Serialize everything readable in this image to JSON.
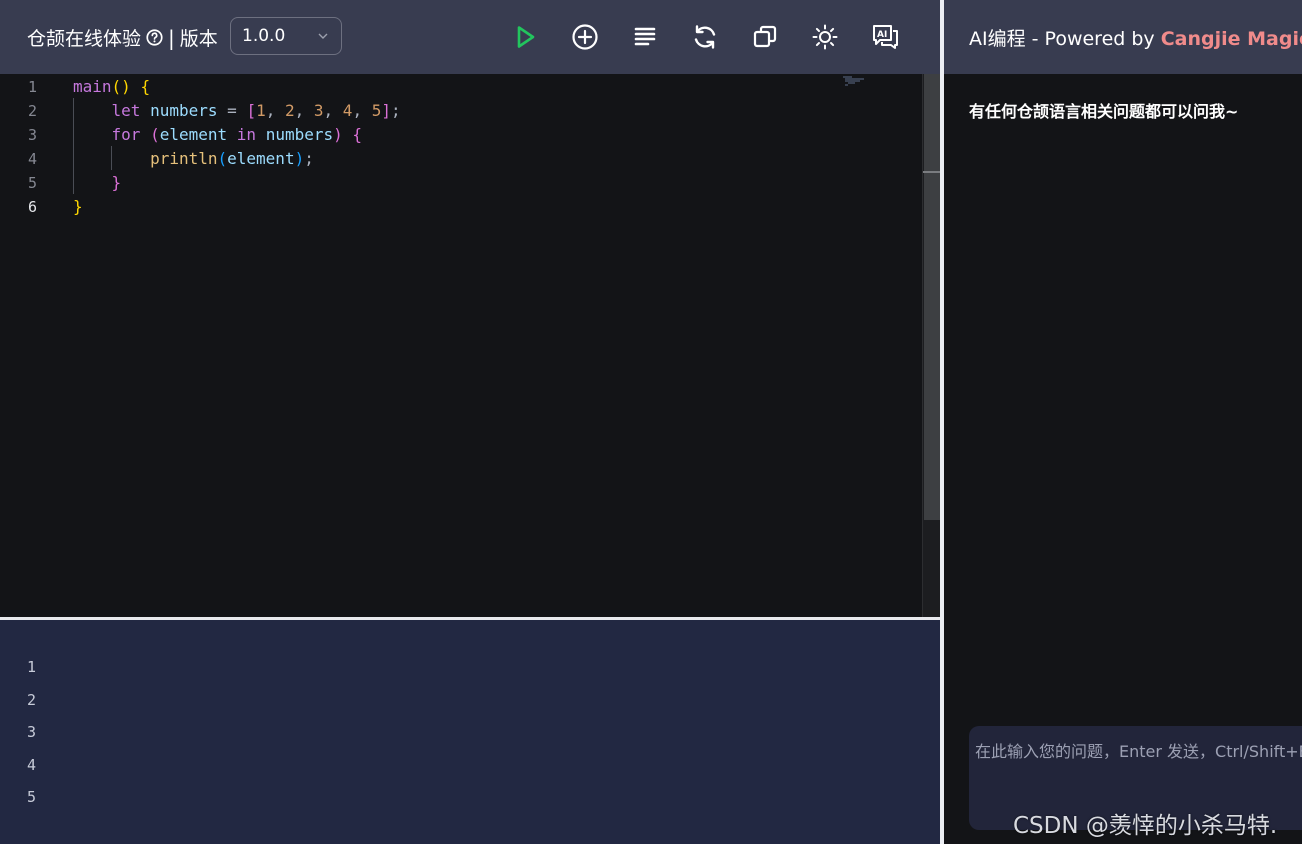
{
  "header": {
    "title": "仓颉在线体验",
    "separator": "|",
    "version_label": "版本",
    "version_value": "1.0.0",
    "toolbar": [
      {
        "name": "run-button",
        "icon": "play-icon"
      },
      {
        "name": "new-button",
        "icon": "plus-circle-icon"
      },
      {
        "name": "format-button",
        "icon": "align-lines-icon"
      },
      {
        "name": "reset-button",
        "icon": "refresh-icon"
      },
      {
        "name": "copy-button",
        "icon": "copy-icon"
      },
      {
        "name": "theme-button",
        "icon": "sun-icon"
      },
      {
        "name": "ai-button",
        "icon": "ai-chat-icon"
      }
    ],
    "run_color": "#22c55e"
  },
  "editor": {
    "line_numbers": [
      "1",
      "2",
      "3",
      "4",
      "5",
      "6"
    ],
    "active_line": "6",
    "code_lines": [
      "main() {",
      "    let numbers = [1, 2, 3, 4, 5];",
      "    for (element in numbers) {",
      "        println(element);",
      "    }",
      "}"
    ]
  },
  "output": {
    "lines": [
      "1",
      "2",
      "3",
      "4",
      "5"
    ]
  },
  "ai_panel": {
    "title_prefix": "AI编程 - Powered by ",
    "title_brand": "Cangjie Magic",
    "brand_color": "#f08b8b",
    "hint": "有任何仓颉语言相关问题都可以问我~",
    "input_placeholder": "在此输入您的问题，Enter 发送，Ctrl/Shift+Enter 换行"
  },
  "watermark": "CSDN @羡悻的小杀马特."
}
